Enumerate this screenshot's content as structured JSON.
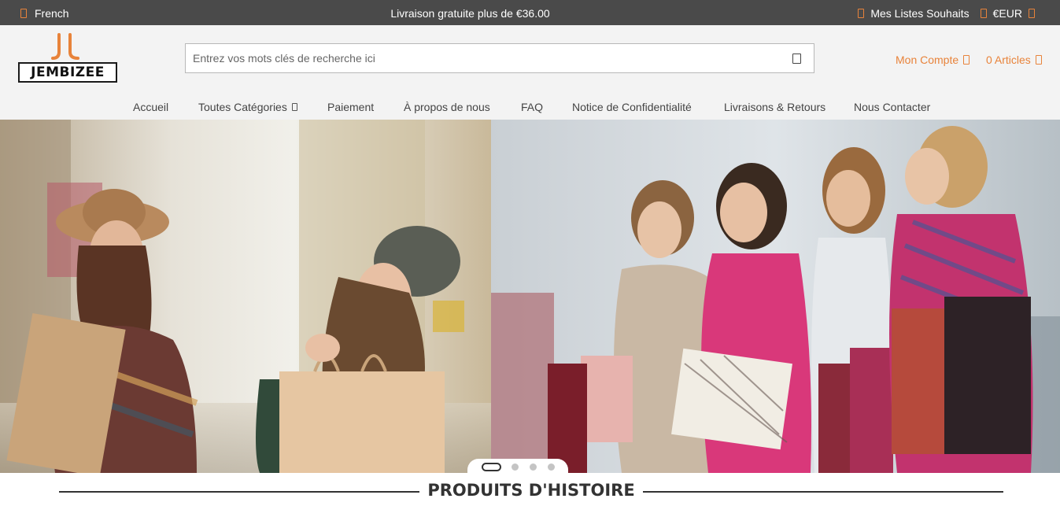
{
  "topbar": {
    "language": "French",
    "promo": "Livraison gratuite plus de €36.00",
    "wishlist": "Mes Listes Souhaits",
    "currency": "€EUR"
  },
  "brand": {
    "name": "JEMBIZEE",
    "accent_color": "#e8833a"
  },
  "search": {
    "placeholder": "Entrez vos mots clés de recherche ici",
    "value": ""
  },
  "account": {
    "label": "Mon Compte",
    "cart_label": "0 Articles"
  },
  "nav": {
    "items": [
      {
        "label": "Accueil"
      },
      {
        "label": "Toutes Catégories"
      },
      {
        "label": "Paiement"
      },
      {
        "label": "À propos de nous"
      },
      {
        "label": "FAQ"
      },
      {
        "label": "Notice de Confidentialité"
      },
      {
        "label": "Livraisons & Retours"
      },
      {
        "label": "Nous Contacter"
      }
    ]
  },
  "hero": {
    "slides_count": 4,
    "active_slide": 1
  },
  "section": {
    "title": "PRODUITS D'HISTOIRE"
  }
}
